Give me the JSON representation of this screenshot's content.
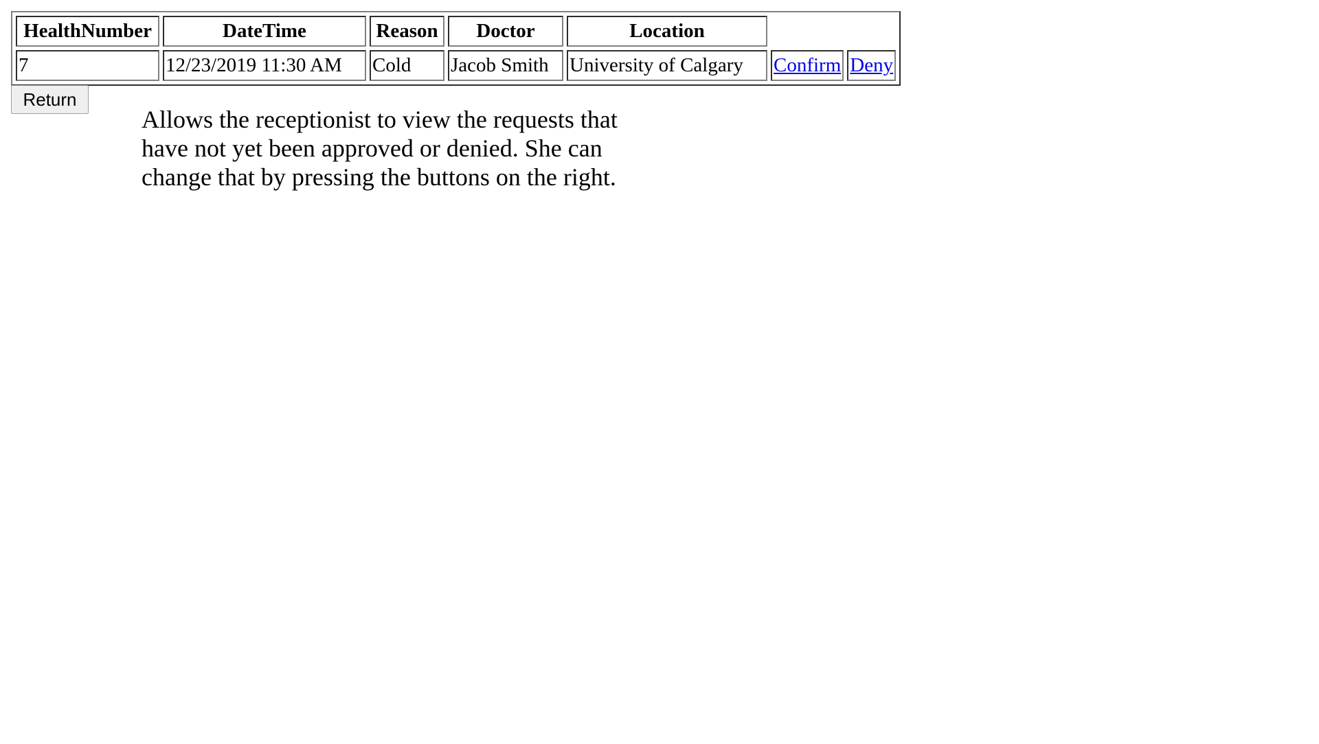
{
  "table": {
    "headers": {
      "health_number": "HealthNumber",
      "date_time": "DateTime",
      "reason": "Reason",
      "doctor": "Doctor",
      "location": "Location"
    },
    "rows": [
      {
        "health_number": "7",
        "date_time": "12/23/2019 11:30 AM",
        "reason": "Cold",
        "doctor": "Jacob Smith",
        "location": "University of Calgary",
        "confirm_label": "Confirm",
        "deny_label": "Deny"
      }
    ]
  },
  "return_button": {
    "label": "Return"
  },
  "description": {
    "text": "Allows the receptionist to view the requests that have not yet been approved or denied. She can change that by pressing the buttons on the right."
  },
  "colors": {
    "link": "#0000ee",
    "button_background": "#efefef"
  }
}
